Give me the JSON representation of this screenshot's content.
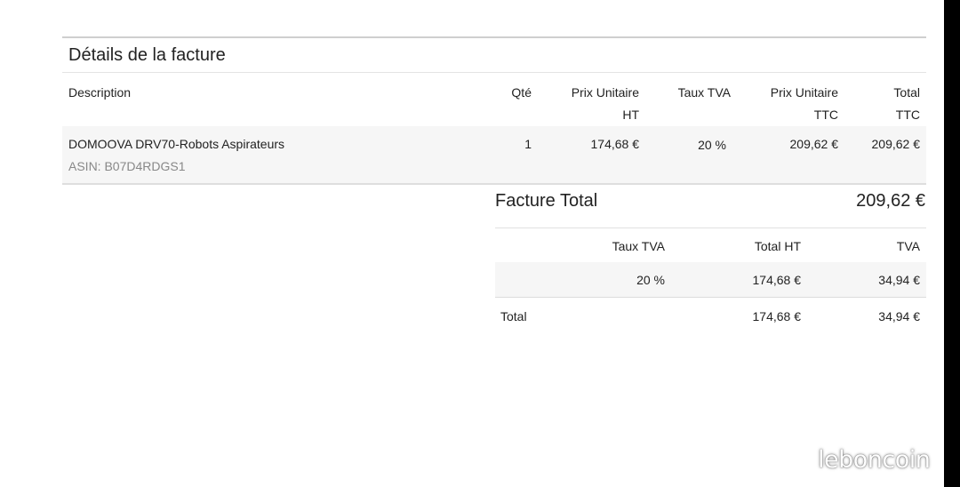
{
  "title": "Détails de la facture",
  "columns": {
    "description": "Description",
    "qte": "Qté",
    "prix_ht_1": "Prix Unitaire",
    "prix_ht_2": "HT",
    "taux_tva": "Taux TVA",
    "prix_ttc_1": "Prix Unitaire",
    "prix_ttc_2": "TTC",
    "total_1": "Total",
    "total_2": "TTC"
  },
  "item": {
    "description": "DOMOOVA DRV70-Robots Aspirateurs",
    "asin": "ASIN: B07D4RDGS1",
    "qte": "1",
    "prix_ht": "174,68 €",
    "taux_tva": "20 %",
    "prix_ttc": "209,62 €",
    "total_ttc": "209,62 €"
  },
  "facture_total": {
    "label": "Facture Total",
    "value": "209,62 €"
  },
  "tva_table": {
    "headers": {
      "taux": "Taux TVA",
      "total_ht": "Total HT",
      "tva": "TVA"
    },
    "row": {
      "taux": "20 %",
      "total_ht": "174,68 €",
      "tva": "34,94 €"
    },
    "total": {
      "label": "Total",
      "total_ht": "174,68 €",
      "tva": "34,94 €"
    }
  },
  "watermark": "leboncoin"
}
